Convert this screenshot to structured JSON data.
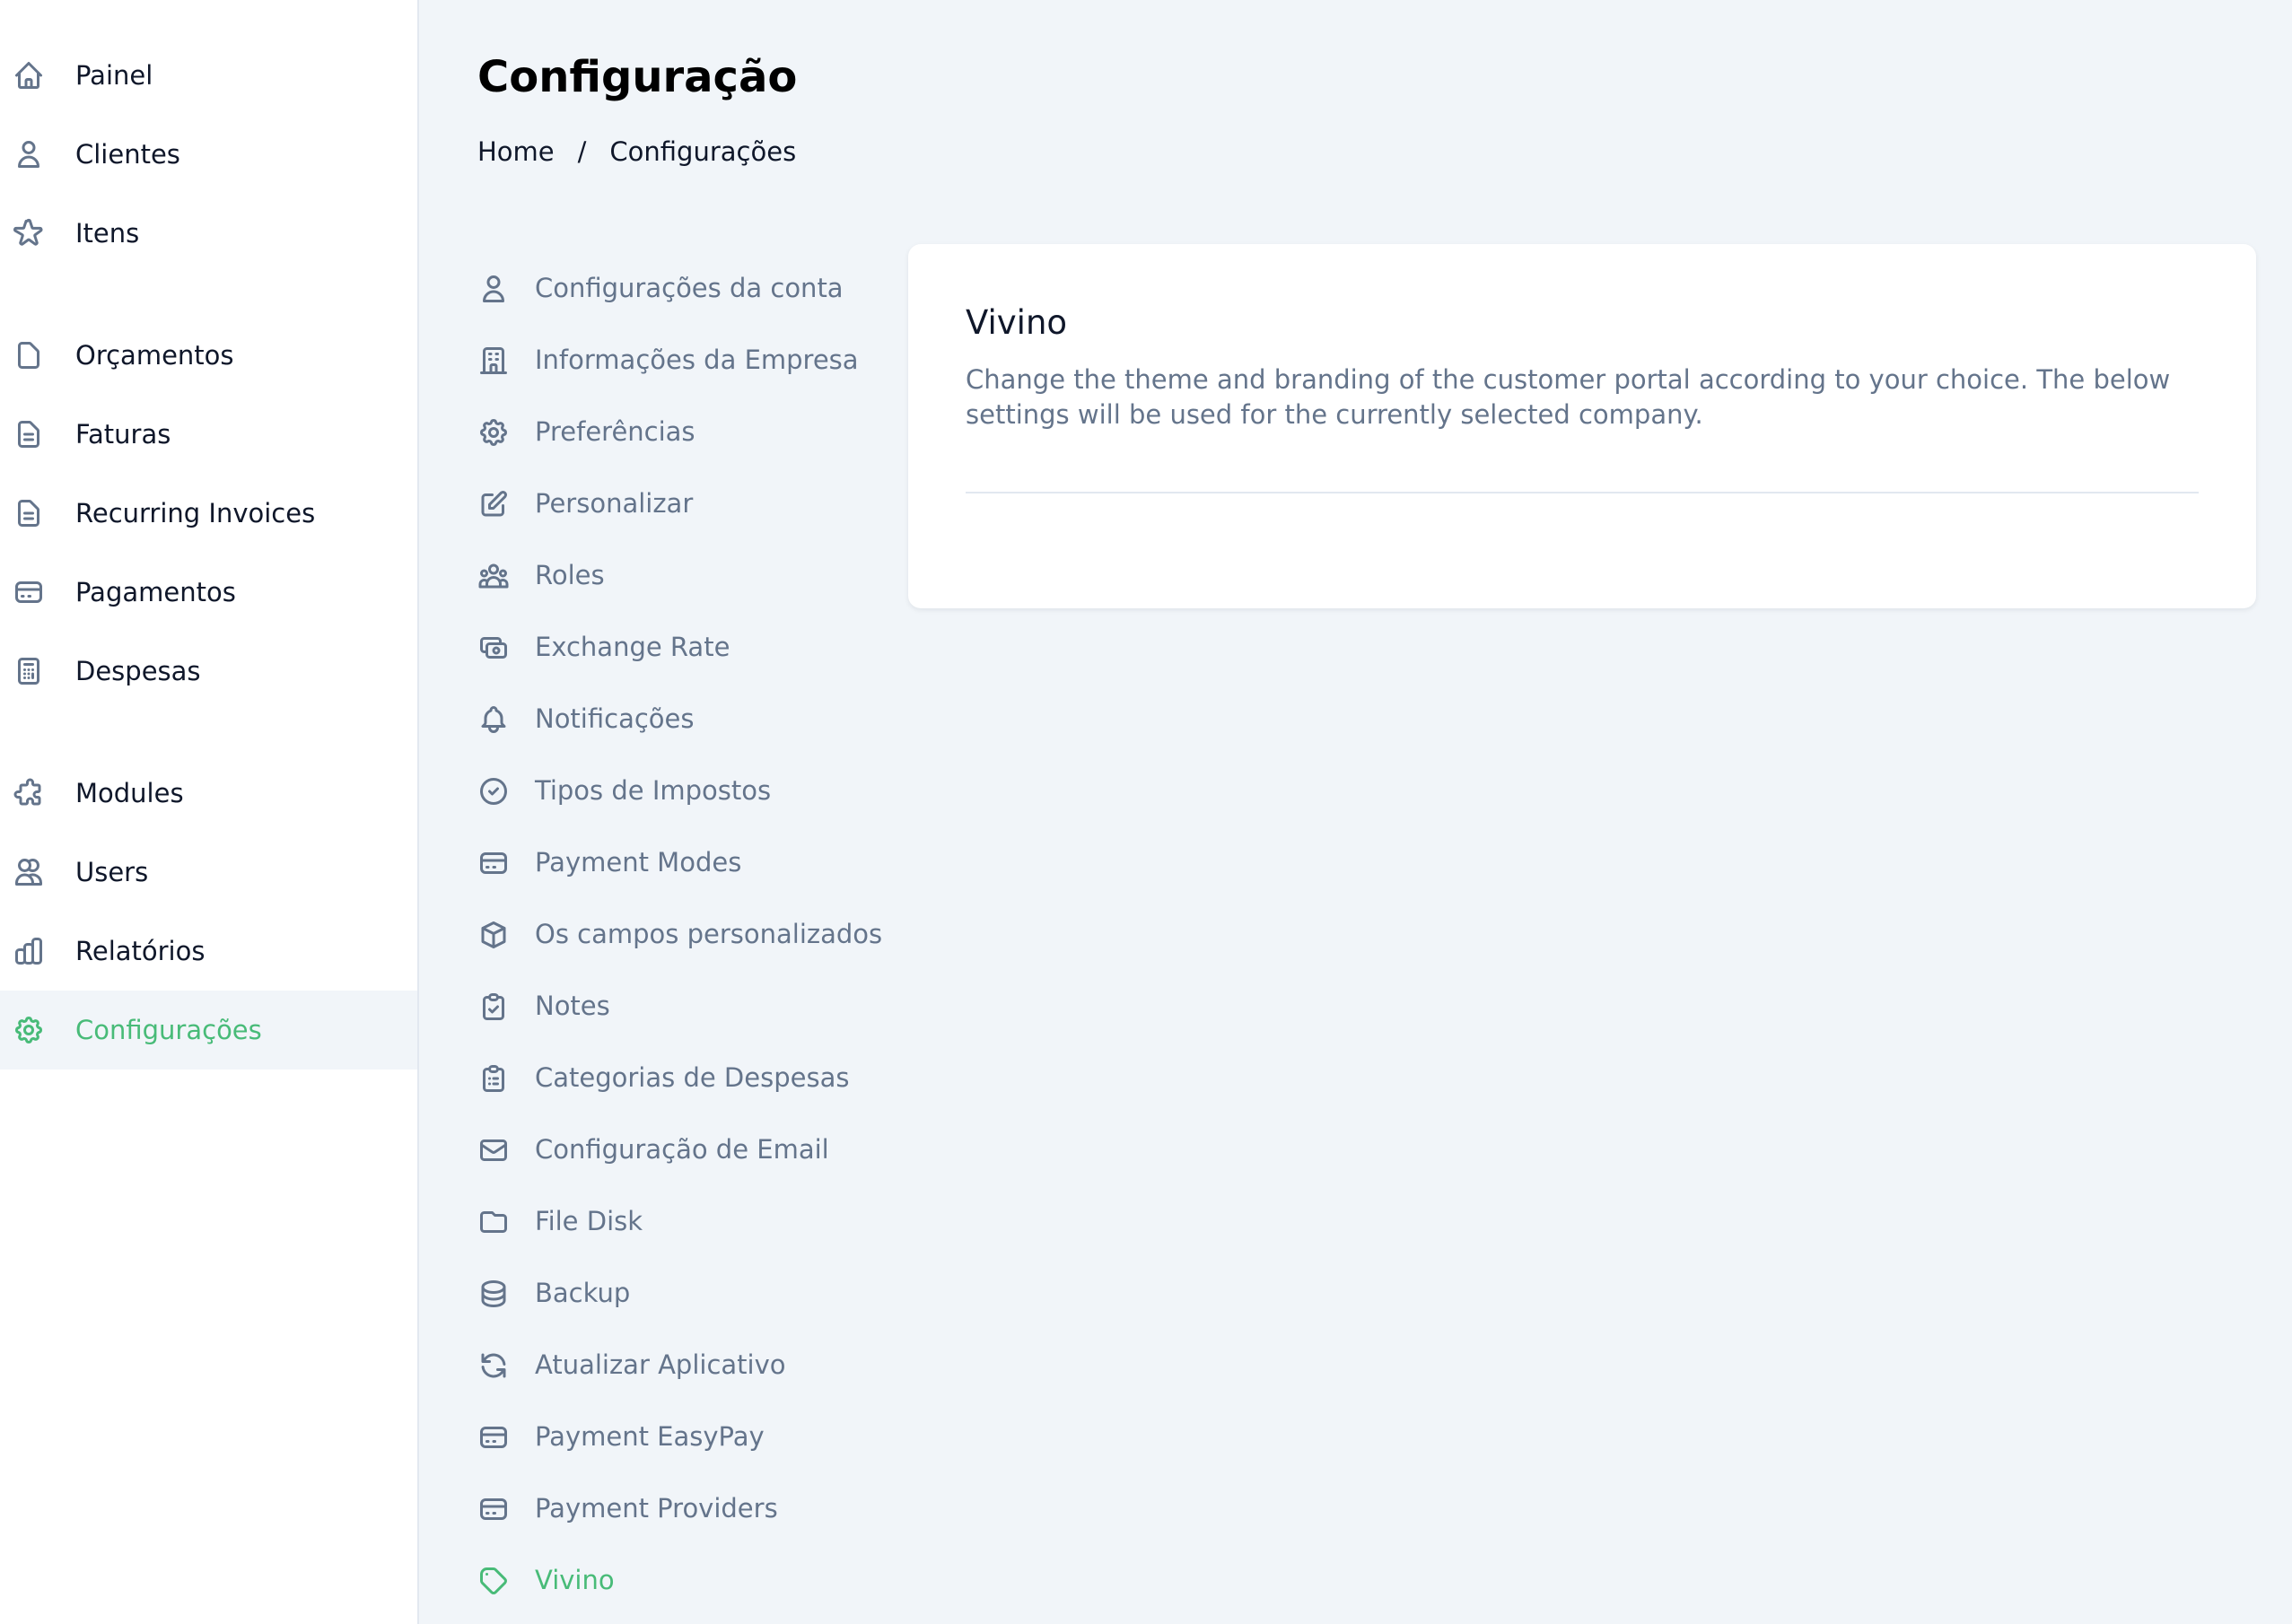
{
  "sidebar": {
    "items": [
      {
        "label": "Painel",
        "icon": "home-icon"
      },
      {
        "label": "Clientes",
        "icon": "user-icon"
      },
      {
        "label": "Itens",
        "icon": "star-icon"
      },
      {
        "label": "Orçamentos",
        "icon": "document-icon"
      },
      {
        "label": "Faturas",
        "icon": "document-text-icon"
      },
      {
        "label": "Recurring Invoices",
        "icon": "document-text-icon"
      },
      {
        "label": "Pagamentos",
        "icon": "credit-card-icon"
      },
      {
        "label": "Despesas",
        "icon": "calculator-icon"
      },
      {
        "label": "Modules",
        "icon": "puzzle-icon"
      },
      {
        "label": "Users",
        "icon": "users-icon"
      },
      {
        "label": "Relatórios",
        "icon": "chart-bar-icon"
      },
      {
        "label": "Configurações",
        "icon": "cog-icon",
        "active": true
      }
    ]
  },
  "header": {
    "title": "Configuração",
    "breadcrumb": {
      "home": "Home",
      "separator": "/",
      "current": "Configurações"
    }
  },
  "settings_menu": {
    "items": [
      {
        "label": "Configurações da conta",
        "icon": "user-icon"
      },
      {
        "label": "Informações da Empresa",
        "icon": "office-building-icon"
      },
      {
        "label": "Preferências",
        "icon": "cog-icon"
      },
      {
        "label": "Personalizar",
        "icon": "pencil-alt-icon"
      },
      {
        "label": "Roles",
        "icon": "user-group-icon"
      },
      {
        "label": "Exchange Rate",
        "icon": "cash-icon"
      },
      {
        "label": "Notificações",
        "icon": "bell-icon"
      },
      {
        "label": "Tipos de Impostos",
        "icon": "check-circle-icon"
      },
      {
        "label": "Payment Modes",
        "icon": "credit-card-icon"
      },
      {
        "label": "Os campos personalizados",
        "icon": "cube-icon"
      },
      {
        "label": "Notes",
        "icon": "clipboard-check-icon"
      },
      {
        "label": "Categorias de Despesas",
        "icon": "clipboard-list-icon"
      },
      {
        "label": "Configuração de Email",
        "icon": "mail-icon"
      },
      {
        "label": "File Disk",
        "icon": "folder-icon"
      },
      {
        "label": "Backup",
        "icon": "database-icon"
      },
      {
        "label": "Atualizar Aplicativo",
        "icon": "refresh-icon"
      },
      {
        "label": "Payment EasyPay",
        "icon": "credit-card-icon"
      },
      {
        "label": "Payment Providers",
        "icon": "credit-card-icon"
      },
      {
        "label": "Vivino",
        "icon": "tag-icon",
        "active": true
      }
    ]
  },
  "card": {
    "title": "Vivino",
    "description": "Change the theme and branding of the customer portal according to your choice. The below settings will be used for the currently selected company."
  },
  "colors": {
    "accent": "#48bb78",
    "text": "#0f172a",
    "muted": "#64748b",
    "background": "#f1f5f9"
  }
}
